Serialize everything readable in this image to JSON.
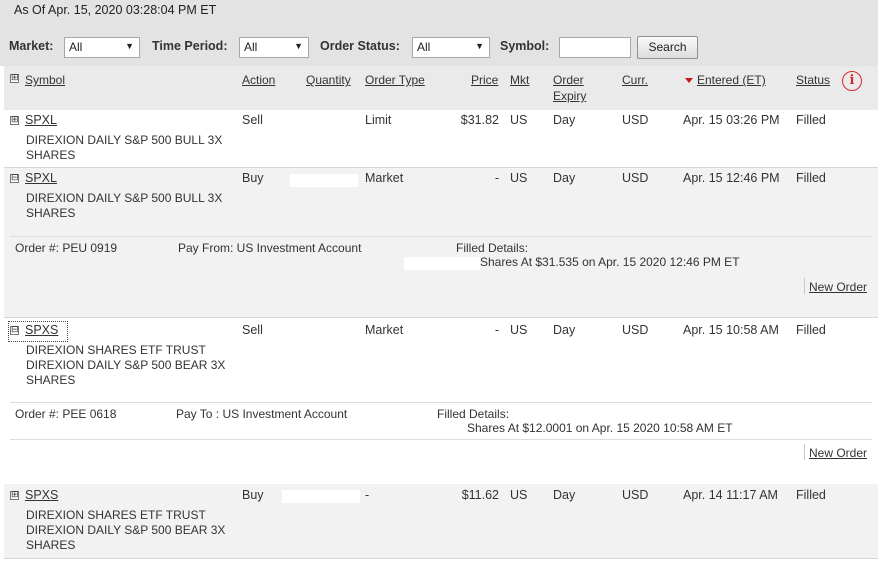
{
  "as_of": "As Of Apr. 15, 2020 03:28:04 PM ET",
  "filters": {
    "market_label": "Market:",
    "market_value": "All",
    "period_label": "Time Period:",
    "period_value": "All",
    "status_label": "Order Status:",
    "status_value": "All",
    "symbol_label": "Symbol:",
    "symbol_value": "",
    "search_label": "Search"
  },
  "columns": {
    "toggle": "⊞",
    "symbol": "Symbol",
    "action": "Action",
    "quantity": "Quantity",
    "order_type": "Order Type",
    "price": "Price",
    "mkt": "Mkt",
    "order_expiry_1": "Order",
    "order_expiry_2": "Expiry",
    "curr": "Curr.",
    "entered": "Entered (ET)",
    "status": "Status",
    "info_icon": "i"
  },
  "orders": [
    {
      "toggle": "⊞",
      "symbol": "SPXL",
      "desc": [
        "DIREXION DAILY S&P 500 BULL 3X",
        "SHARES"
      ],
      "action": "Sell",
      "order_type": "Limit",
      "price": "$31.82",
      "mkt": "US",
      "expiry": "Day",
      "curr": "USD",
      "entered": "Apr. 15 03:26 PM",
      "status": "Filled"
    },
    {
      "toggle": "⊟",
      "symbol": "SPXL",
      "desc": [
        "DIREXION DAILY S&P 500 BULL 3X",
        "SHARES"
      ],
      "action": "Buy",
      "order_type": "Market",
      "price": "-",
      "mkt": "US",
      "expiry": "Day",
      "curr": "USD",
      "entered": "Apr. 15 12:46 PM",
      "status": "Filled",
      "details": {
        "order_no": "Order #: PEU 0919",
        "pay": "Pay From: US Investment Account",
        "filled_label": "Filled Details:",
        "filled_text": "Shares At $31.535 on Apr. 15 2020 12:46 PM ET",
        "new_order": "New Order"
      }
    },
    {
      "toggle": "⊟",
      "symbol": "SPXS",
      "desc": [
        "DIREXION SHARES ETF TRUST",
        "DIREXION DAILY S&P 500 BEAR 3X",
        "SHARES"
      ],
      "action": "Sell",
      "order_type": "Market",
      "price": "-",
      "mkt": "US",
      "expiry": "Day",
      "curr": "USD",
      "entered": "Apr. 15 10:58 AM",
      "status": "Filled",
      "details": {
        "order_no": "Order #: PEE 0618",
        "pay": "Pay To : US Investment Account",
        "filled_label": "Filled Details:",
        "filled_text": "Shares At $12.0001 on Apr. 15 2020 10:58 AM ET",
        "new_order": "New Order"
      }
    },
    {
      "toggle": "⊞",
      "symbol": "SPXS",
      "desc": [
        "DIREXION SHARES ETF TRUST",
        "DIREXION DAILY S&P 500 BEAR 3X",
        "SHARES"
      ],
      "action": "Buy",
      "order_type": "-",
      "price": "$11.62",
      "mkt": "US",
      "expiry": "Day",
      "curr": "USD",
      "entered": "Apr. 14 11:17 AM",
      "status": "Filled"
    }
  ]
}
